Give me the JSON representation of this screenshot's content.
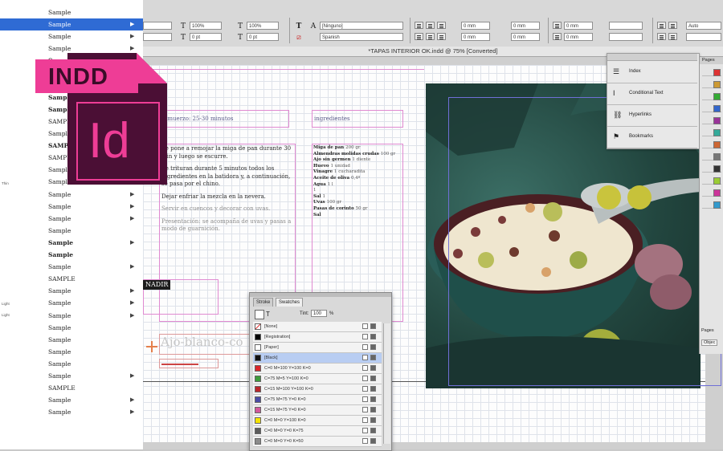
{
  "app": {
    "document_title": "*TAPAS INTERIOR OK.indd @ 75% [Converted]",
    "file_type_badge": "INDD",
    "logo_letters": "Id"
  },
  "font_menu": {
    "items": [
      {
        "label": "Sample",
        "submenu": false
      },
      {
        "label": "Sample",
        "submenu": true,
        "selected": true
      },
      {
        "label": "Sample",
        "submenu": true
      },
      {
        "label": "Sample",
        "submenu": true
      },
      {
        "label": "Sample",
        "submenu": false
      },
      {
        "label": "Sample",
        "submenu": false
      },
      {
        "label": "Sample",
        "submenu": false
      },
      {
        "label": "Sample",
        "submenu": false
      },
      {
        "label": "Sample",
        "submenu": false
      },
      {
        "label": "SAMPLE",
        "submenu": false
      },
      {
        "label": "Sample",
        "submenu": false
      },
      {
        "label": "SAMPLE",
        "submenu": false
      },
      {
        "label": "SAMPLE",
        "submenu": false
      },
      {
        "label": "Sample",
        "submenu": true
      },
      {
        "label": "Sample",
        "submenu": false
      },
      {
        "label": "Sample",
        "submenu": true
      },
      {
        "label": "Sample",
        "submenu": true
      },
      {
        "label": "Sample",
        "submenu": true
      },
      {
        "label": "Sample",
        "submenu": false
      },
      {
        "label": "Sample",
        "submenu": true
      },
      {
        "label": "Sample",
        "submenu": false
      },
      {
        "label": "Sample",
        "submenu": true
      },
      {
        "label": "SAMPLE",
        "submenu": false
      },
      {
        "label": "Sample",
        "submenu": true
      },
      {
        "label": "Sample",
        "submenu": true
      },
      {
        "label": "Sample",
        "submenu": true
      },
      {
        "label": "Sample",
        "submenu": false
      },
      {
        "label": "Sample",
        "submenu": false
      },
      {
        "label": "Sample",
        "submenu": false
      },
      {
        "label": "Sample",
        "submenu": false
      },
      {
        "label": "Sample",
        "submenu": true
      },
      {
        "label": "SAMPLE",
        "submenu": false
      },
      {
        "label": "Sample",
        "submenu": true
      },
      {
        "label": "Sample",
        "submenu": true
      }
    ],
    "side_labels": [
      "Thin",
      "Light",
      "Light"
    ]
  },
  "control_bar": {
    "font_size_a": "100%",
    "font_size_b": "0 pt",
    "tracking_a": "100%",
    "tracking_b": "0 pt",
    "language_select": "[Ninguno]",
    "style_select": "Spanish",
    "spacing_values": [
      "0 mm",
      "0 mm",
      "0 mm",
      "0 mm",
      "0 mm",
      "0 mm"
    ],
    "right_value": "Auto"
  },
  "layout": {
    "header_left": "almuerzo: 25-30 minutos",
    "header_right": "ingredientes",
    "paragraphs": [
      "Se pone a remojar la miga de pan durante 30 min y luego se escurre.",
      "Se trituran durante 5 minutos todos los ingredientes en la batidora y, a continuación, se pasa por el chino.",
      "Dejar enfriar la mezcla en la nevera.",
      "Servir en cuencos y decorar con uvas.",
      "Presentación: se acompaña de uvas y pasas a modo de guarnición."
    ],
    "ingredients": [
      {
        "name": "Miga de pan",
        "qty": "200 gr"
      },
      {
        "name": "Almendras molidas crudas",
        "qty": "100 gr"
      },
      {
        "name": "Ajo sin germen",
        "qty": "1 diente"
      },
      {
        "name": "Huevo",
        "qty": "1 unidad"
      },
      {
        "name": "Vinagre",
        "qty": "1 cucharadita"
      },
      {
        "name": "Aceite de oliva",
        "qty": "0,4º"
      },
      {
        "name": "Agua",
        "qty": "1 l"
      },
      {
        "name": "",
        "qty": "1"
      },
      {
        "name": "Sal",
        "qty": "1"
      },
      {
        "name": "Uvas",
        "qty": "100 gr"
      },
      {
        "name": "Pasas de corinto",
        "qty": "50 gr"
      },
      {
        "name": "Sal",
        "qty": ""
      }
    ],
    "nadir_label": "NADIR",
    "recipe_title": "Ajo-blanco-co"
  },
  "panel_menu": {
    "items": [
      {
        "label": "Index",
        "icon": "index-icon"
      },
      {
        "label": "Conditional Text",
        "icon": "conditional-text-icon"
      },
      {
        "label": "Hyperlinks",
        "icon": "hyperlinks-icon"
      },
      {
        "label": "Bookmarks",
        "icon": "bookmarks-icon"
      }
    ]
  },
  "pages_panel": {
    "title": "Pages",
    "footer_label": "Pages",
    "footer_sub": "Objec"
  },
  "swatches_panel": {
    "tabs": [
      "Stroke",
      "Swatches"
    ],
    "tint_label": "Tint:",
    "tint_value": "100",
    "tint_unit": "%",
    "swatches": [
      {
        "name": "[None]",
        "color": "#ffffff",
        "special": "none"
      },
      {
        "name": "[Registration]",
        "color": "#000000"
      },
      {
        "name": "[Paper]",
        "color": "#ffffff"
      },
      {
        "name": "[Black]",
        "color": "#111111",
        "selected": true
      },
      {
        "name": "C=0 M=100 Y=100 K=0",
        "color": "#d9262b"
      },
      {
        "name": "C=75 M=5 Y=100 K=0",
        "color": "#3d9b3a"
      },
      {
        "name": "C=15 M=100 Y=100 K=0",
        "color": "#b9262a"
      },
      {
        "name": "C=75 M=75 Y=0 K=0",
        "color": "#4a4ba5"
      },
      {
        "name": "C=15 M=75 Y=0 K=0",
        "color": "#d2589b"
      },
      {
        "name": "C=0 M=0 Y=100 K=0",
        "color": "#f6e400"
      },
      {
        "name": "C=0 M=0 Y=0 K=75",
        "color": "#5c5c5c"
      },
      {
        "name": "C=0 M=0 Y=0 K=50",
        "color": "#8c8c8c"
      }
    ]
  },
  "colors": {
    "menu_highlight": "#2f6bd4",
    "indesign_pink": "#ee3d96",
    "indesign_dark": "#4b0f35",
    "frame_pink": "#e08ad1"
  }
}
